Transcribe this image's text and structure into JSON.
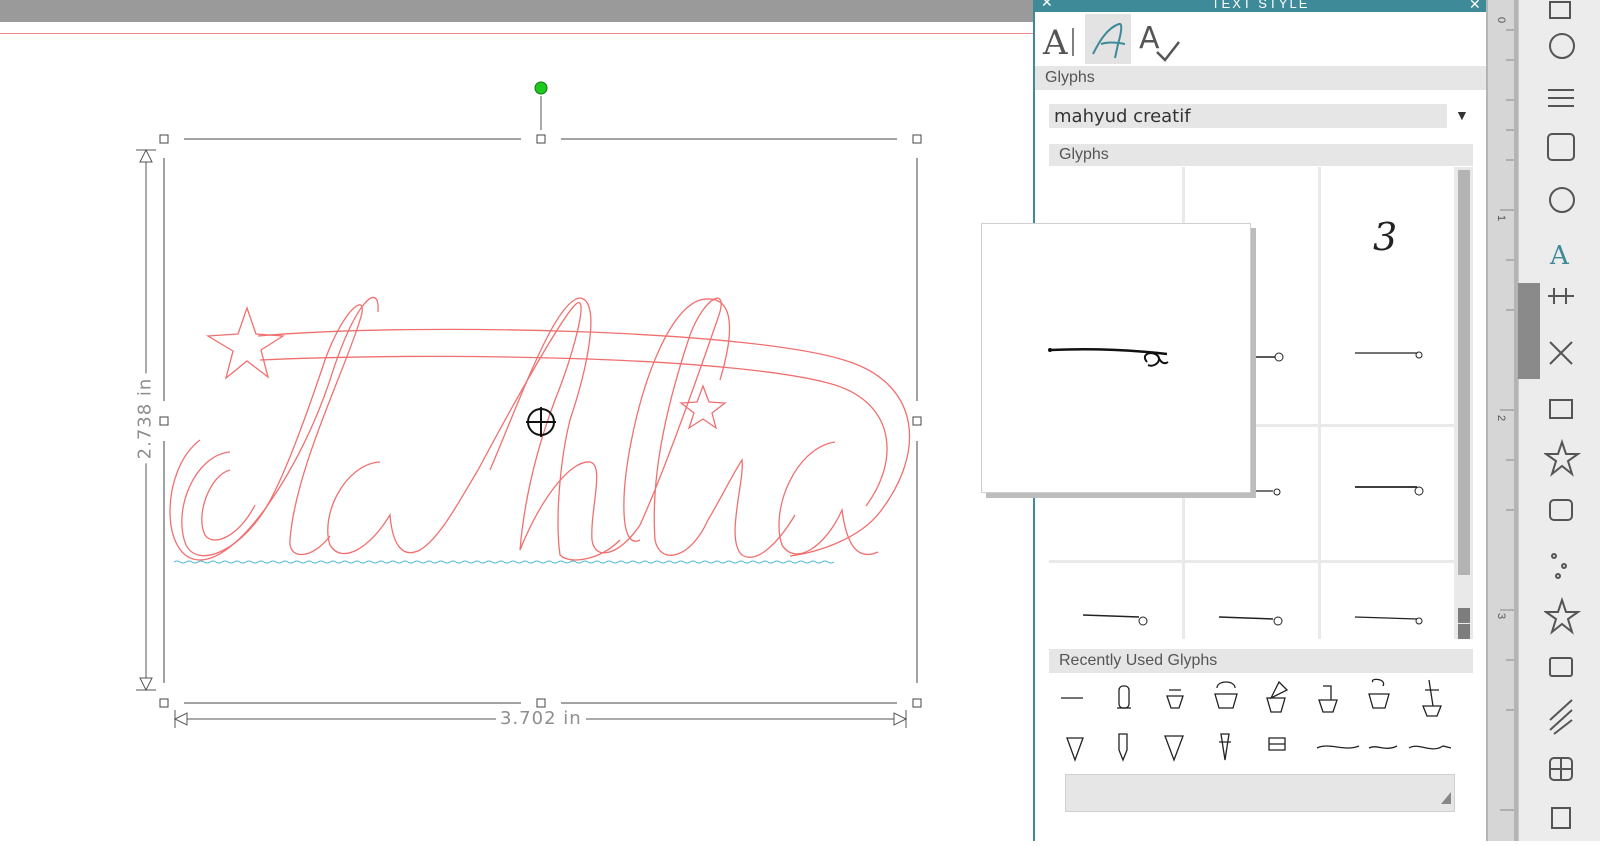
{
  "canvas": {
    "width_label": "3.702 in",
    "height_label": "2.738 in",
    "design_text": "dahlia"
  },
  "panel": {
    "title": "TEXT STYLE",
    "tabs": [
      {
        "name": "text-style",
        "glyph": "A|"
      },
      {
        "name": "glyphs",
        "glyph": "A"
      },
      {
        "name": "spellcheck",
        "glyph": "A✓"
      }
    ],
    "section_label": "Glyphs",
    "font_name": "mahyud creatif",
    "glyphs_label": "Glyphs",
    "recent_label": "Recently Used Glyphs",
    "visible_glyph_chars": [
      "3"
    ]
  },
  "ruler": {
    "marks": [
      "0",
      "1",
      "2",
      "3"
    ]
  },
  "colors": {
    "accent": "#3e8a99",
    "cut_line": "#f08a8a",
    "handle_green": "#1ec81e",
    "baseline": "#4db7d8"
  }
}
